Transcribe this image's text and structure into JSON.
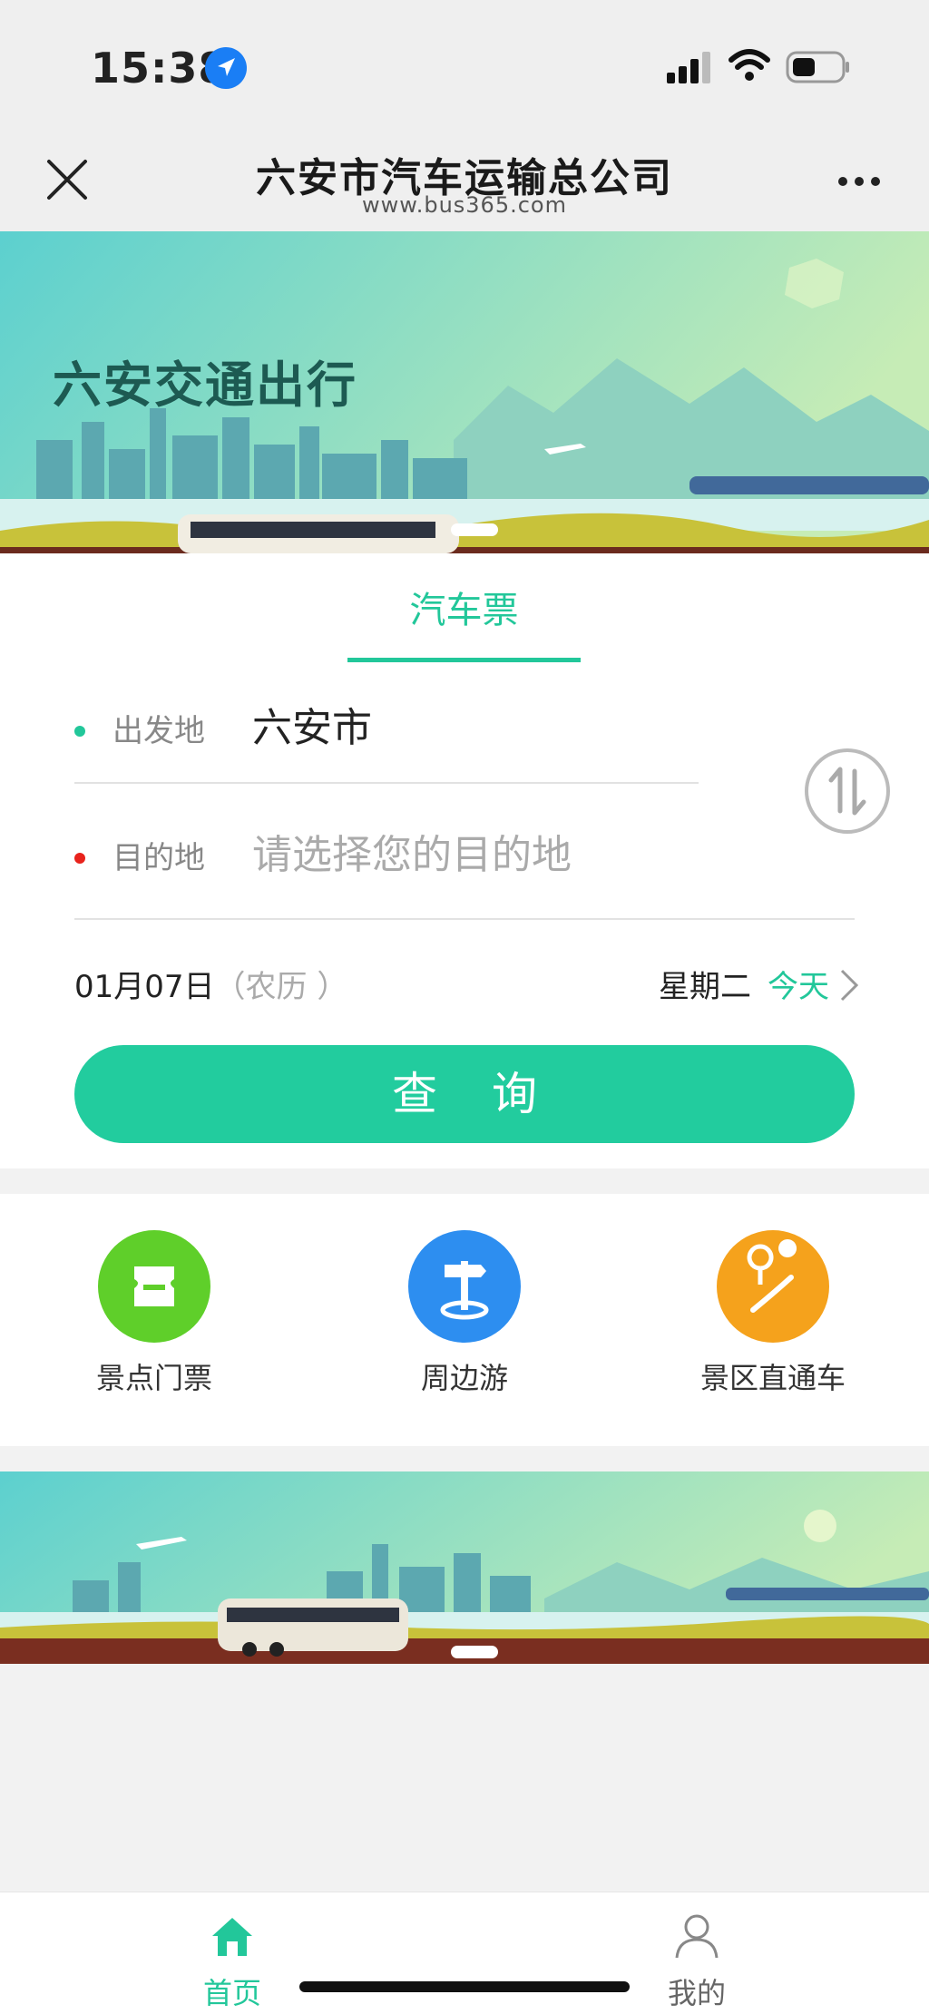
{
  "status": {
    "time": "15:38"
  },
  "header": {
    "title": "六安市汽车运输总公司",
    "url": "www.bus365.com"
  },
  "banner": {
    "headline": "六安交通出行"
  },
  "search": {
    "tab": "汽车票",
    "departure_label": "出发地",
    "departure_value": "六安市",
    "destination_label": "目的地",
    "destination_placeholder": "请选择您的目的地",
    "date": "01月07日",
    "lunar": "（农历 ）",
    "weekday": "星期二",
    "today": "今天",
    "query_button": "查询"
  },
  "features": [
    {
      "label": "景点门票",
      "icon": "ticket-icon",
      "color": "#5fcf2a"
    },
    {
      "label": "周边游",
      "icon": "signpost-icon",
      "color": "#2d8ef0"
    },
    {
      "label": "景区直通车",
      "icon": "map-pin-icon",
      "color": "#f5a21c"
    }
  ],
  "nav": [
    {
      "label": "首页",
      "icon": "home-icon",
      "active": true
    },
    {
      "label": "我的",
      "icon": "user-icon",
      "active": false
    }
  ],
  "colors": {
    "accent": "#22c79a",
    "departure_dot": "#22c79a",
    "destination_dot": "#e8231c"
  }
}
